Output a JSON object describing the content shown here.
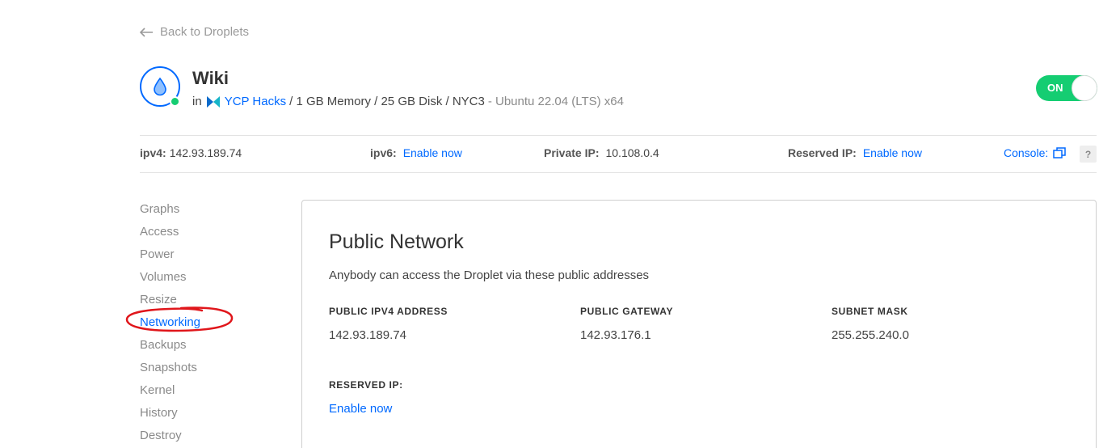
{
  "back": {
    "label": "Back to Droplets"
  },
  "droplet": {
    "name": "Wiki",
    "in_label": "in",
    "project": "YCP Hacks",
    "specs": "/ 1 GB Memory / 25 GB Disk / NYC3",
    "os": "- Ubuntu 22.04 (LTS) x64",
    "power_label": "ON"
  },
  "infobar": {
    "ipv4_key": "ipv4:",
    "ipv4_value": "142.93.189.74",
    "ipv6_key": "ipv6:",
    "ipv6_link": "Enable now",
    "private_key": "Private IP:",
    "private_value": "10.108.0.4",
    "reserved_key": "Reserved IP:",
    "reserved_link": "Enable now",
    "console_label": "Console:",
    "help_label": "?"
  },
  "sidenav": {
    "items": [
      {
        "label": "Graphs"
      },
      {
        "label": "Access"
      },
      {
        "label": "Power"
      },
      {
        "label": "Volumes"
      },
      {
        "label": "Resize"
      },
      {
        "label": "Networking"
      },
      {
        "label": "Backups"
      },
      {
        "label": "Snapshots"
      },
      {
        "label": "Kernel"
      },
      {
        "label": "History"
      },
      {
        "label": "Destroy"
      }
    ],
    "active_index": 5
  },
  "public_network": {
    "title": "Public Network",
    "description": "Anybody can access the Droplet via these public addresses",
    "ipv4_label": "PUBLIC IPV4 ADDRESS",
    "ipv4_value": "142.93.189.74",
    "gateway_label": "PUBLIC GATEWAY",
    "gateway_value": "142.93.176.1",
    "mask_label": "SUBNET MASK",
    "mask_value": "255.255.240.0",
    "reserved_label": "RESERVED IP:",
    "reserved_link": "Enable now"
  },
  "colors": {
    "accent": "#0069ff",
    "status_on": "#15cd72",
    "annotation": "#e0161b"
  },
  "icons": [
    "arrow-left-icon",
    "droplet-icon",
    "ycp-hacks-logo-icon",
    "external-window-icon"
  ]
}
